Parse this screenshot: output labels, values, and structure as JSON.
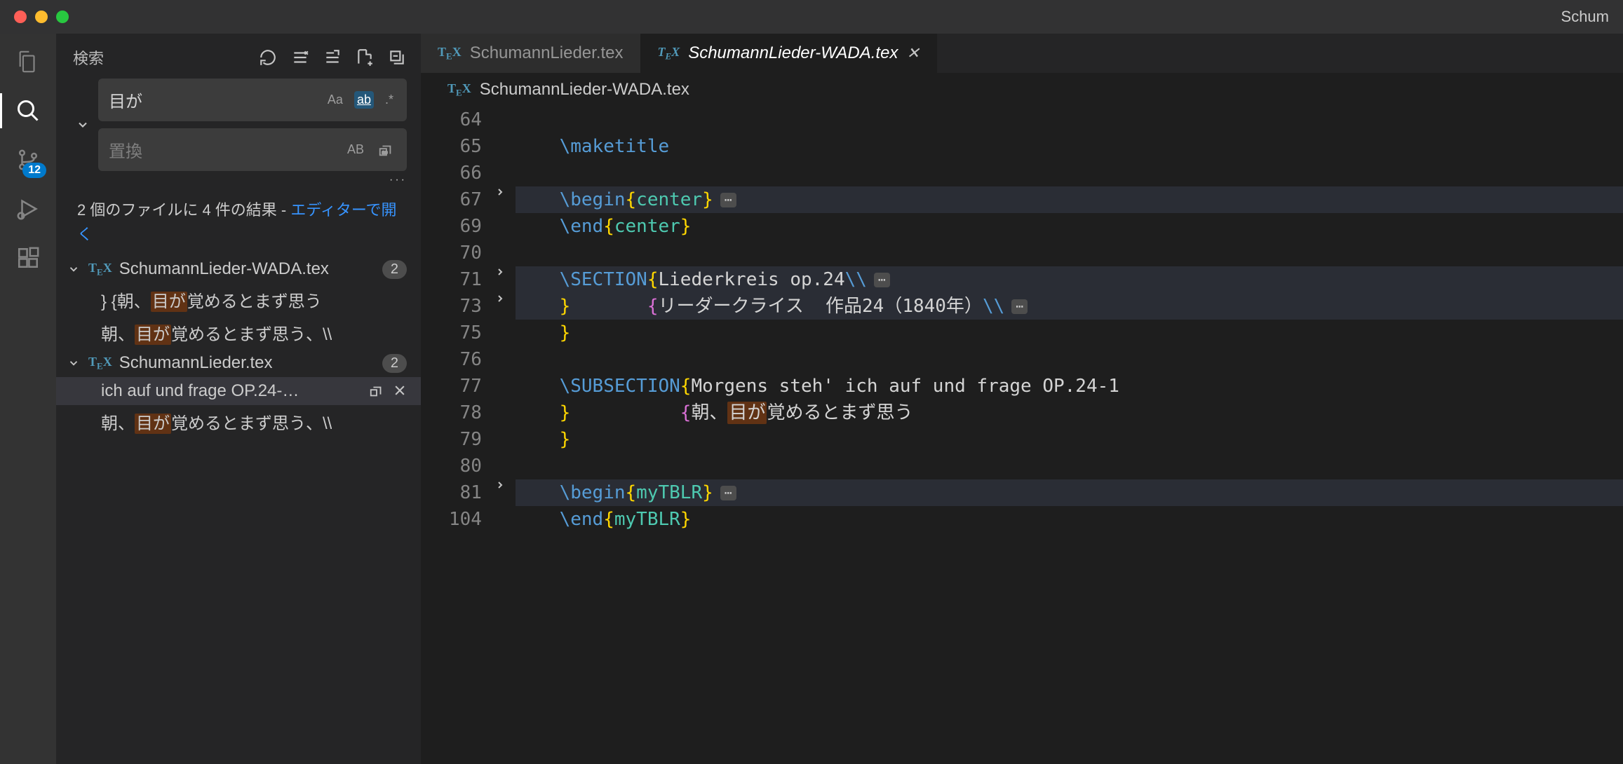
{
  "window": {
    "title": "Schum"
  },
  "activityBar": {
    "badge": "12"
  },
  "search": {
    "title": "検索",
    "query": "目が",
    "replacePlaceholder": "置換",
    "caseLabel": "Aa",
    "wholeWordLabel": "ab",
    "regexLabel": ".*",
    "preserveCaseLabel": "AB",
    "summary_prefix": "2 個のファイルに 4 件の結果 - ",
    "summary_link": "エディターで開く"
  },
  "results": {
    "files": [
      {
        "name": "SchumannLieder-WADA.tex",
        "count": "2",
        "lines": [
          {
            "pre": "}       {朝、",
            "match": "目が",
            "post": "覚めるとまず思う"
          },
          {
            "pre": "朝、",
            "match": "目が",
            "post": "覚めるとまず思う、\\\\"
          }
        ]
      },
      {
        "name": "SchumannLieder.tex",
        "count": "2",
        "lines": [
          {
            "pre": "ich auf und frage OP.24-…",
            "match": "",
            "post": "",
            "selected": true
          },
          {
            "pre": "朝、",
            "match": "目が",
            "post": "覚めるとまず思う、\\\\"
          }
        ]
      }
    ]
  },
  "editor": {
    "tabs": [
      {
        "label": "SchumannLieder.tex",
        "active": false
      },
      {
        "label": "SchumannLieder-WADA.tex",
        "active": true
      }
    ],
    "breadcrumb": "SchumannLieder-WADA.tex",
    "lines": [
      {
        "num": "64",
        "fold": "",
        "segments": []
      },
      {
        "num": "65",
        "fold": "",
        "indent": "    ",
        "segments": [
          {
            "t": "\\maketitle",
            "c": "kw"
          }
        ]
      },
      {
        "num": "66",
        "fold": "",
        "segments": []
      },
      {
        "num": "67",
        "fold": ">",
        "hl": true,
        "indent": "    ",
        "segments": [
          {
            "t": "\\begin",
            "c": "kw"
          },
          {
            "t": "{",
            "c": "brace"
          },
          {
            "t": "center",
            "c": "ident"
          },
          {
            "t": "}",
            "c": "brace"
          }
        ],
        "dots": true
      },
      {
        "num": "69",
        "fold": "",
        "indent": "    ",
        "segments": [
          {
            "t": "\\end",
            "c": "kw"
          },
          {
            "t": "{",
            "c": "brace"
          },
          {
            "t": "center",
            "c": "ident"
          },
          {
            "t": "}",
            "c": "brace"
          }
        ]
      },
      {
        "num": "70",
        "fold": "",
        "segments": []
      },
      {
        "num": "71",
        "fold": ">",
        "hl": true,
        "indent": "    ",
        "segments": [
          {
            "t": "\\SECTION",
            "c": "kw"
          },
          {
            "t": "{",
            "c": "brace"
          },
          {
            "t": "Liederkreis op.24",
            "c": "text"
          },
          {
            "t": "\\\\",
            "c": "kw"
          }
        ],
        "dots": true
      },
      {
        "num": "73",
        "fold": ">",
        "hl": true,
        "indent": "    ",
        "segments": [
          {
            "t": "}",
            "c": "brace"
          },
          {
            "t": "       ",
            "c": "text"
          },
          {
            "t": "{",
            "c": "brace2"
          },
          {
            "t": "リーダークライス  作品24（1840年）",
            "c": "text"
          },
          {
            "t": "\\\\",
            "c": "kw"
          }
        ],
        "dots": true
      },
      {
        "num": "75",
        "fold": "",
        "indent": "    ",
        "segments": [
          {
            "t": "}",
            "c": "brace"
          }
        ]
      },
      {
        "num": "76",
        "fold": "",
        "segments": []
      },
      {
        "num": "77",
        "fold": "",
        "indent": "    ",
        "segments": [
          {
            "t": "\\SUBSECTION",
            "c": "kw"
          },
          {
            "t": "{",
            "c": "brace"
          },
          {
            "t": "Morgens steh' ich auf und frage OP.24-1",
            "c": "text"
          }
        ]
      },
      {
        "num": "78",
        "fold": "",
        "indent": "    ",
        "segments": [
          {
            "t": "}",
            "c": "brace"
          },
          {
            "t": "          ",
            "c": "text"
          },
          {
            "t": "{",
            "c": "brace2"
          },
          {
            "t": "朝、",
            "c": "text"
          },
          {
            "t": "目が",
            "c": "text",
            "edhl": true
          },
          {
            "t": "覚めるとまず思う",
            "c": "text"
          }
        ]
      },
      {
        "num": "79",
        "fold": "",
        "indent": "    ",
        "segments": [
          {
            "t": "}",
            "c": "brace"
          }
        ]
      },
      {
        "num": "80",
        "fold": "",
        "segments": []
      },
      {
        "num": "81",
        "fold": ">",
        "hl": true,
        "indent": "    ",
        "segments": [
          {
            "t": "\\begin",
            "c": "kw"
          },
          {
            "t": "{",
            "c": "brace"
          },
          {
            "t": "myTBLR",
            "c": "ident"
          },
          {
            "t": "}",
            "c": "brace"
          }
        ],
        "dots": true
      },
      {
        "num": "104",
        "fold": "",
        "indent": "    ",
        "segments": [
          {
            "t": "\\end",
            "c": "kw"
          },
          {
            "t": "{",
            "c": "brace"
          },
          {
            "t": "myTBLR",
            "c": "ident"
          },
          {
            "t": "}",
            "c": "brace"
          }
        ]
      }
    ]
  }
}
